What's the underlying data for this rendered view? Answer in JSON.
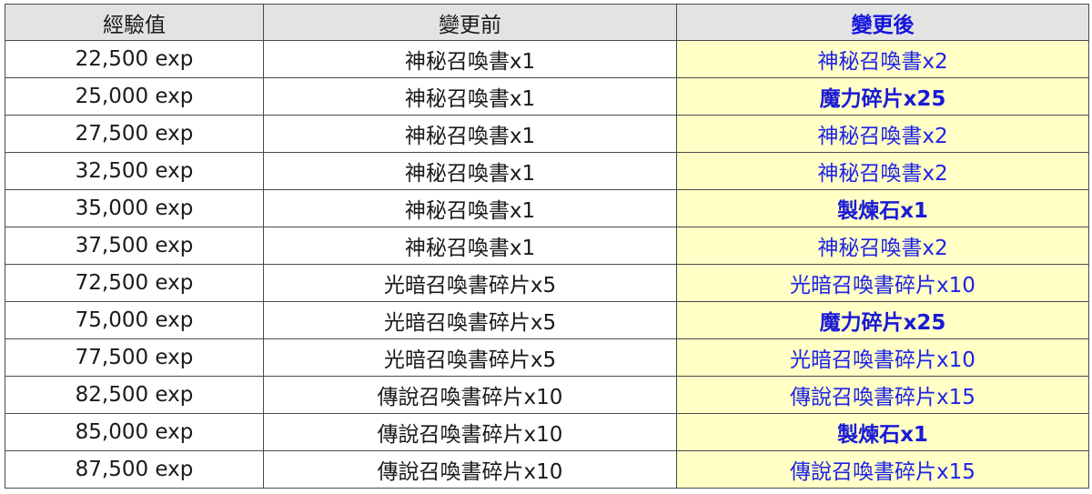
{
  "table": {
    "headers": {
      "exp": "經驗值",
      "before": "變更前",
      "after": "變更後"
    },
    "rows": [
      {
        "exp": "22,500 exp",
        "before": "神秘召喚書x1",
        "after": "神秘召喚書x2",
        "after_bold": false
      },
      {
        "exp": "25,000 exp",
        "before": "神秘召喚書x1",
        "after": "魔力碎片x25",
        "after_bold": true
      },
      {
        "exp": "27,500 exp",
        "before": "神秘召喚書x1",
        "after": "神秘召喚書x2",
        "after_bold": false
      },
      {
        "exp": "32,500 exp",
        "before": "神秘召喚書x1",
        "after": "神秘召喚書x2",
        "after_bold": false
      },
      {
        "exp": "35,000 exp",
        "before": "神秘召喚書x1",
        "after": "製煉石x1",
        "after_bold": true
      },
      {
        "exp": "37,500 exp",
        "before": "神秘召喚書x1",
        "after": "神秘召喚書x2",
        "after_bold": false
      },
      {
        "exp": "72,500 exp",
        "before": "光暗召喚書碎片x5",
        "after": "光暗召喚書碎片x10",
        "after_bold": false
      },
      {
        "exp": "75,000 exp",
        "before": "光暗召喚書碎片x5",
        "after": "魔力碎片x25",
        "after_bold": true
      },
      {
        "exp": "77,500 exp",
        "before": "光暗召喚書碎片x5",
        "after": "光暗召喚書碎片x10",
        "after_bold": false
      },
      {
        "exp": "82,500 exp",
        "before": "傳說召喚書碎片x10",
        "after": "傳說召喚書碎片x15",
        "after_bold": false
      },
      {
        "exp": "85,000 exp",
        "before": "傳說召喚書碎片x10",
        "after": "製煉石x1",
        "after_bold": true
      },
      {
        "exp": "87,500 exp",
        "before": "傳說召喚書碎片x10",
        "after": "傳說召喚書碎片x15",
        "after_bold": false
      }
    ]
  },
  "colors": {
    "header_bg": "#e3e3e3",
    "after_bg": "#ffffc6",
    "after_text": "#1e22e6",
    "border": "#4a4a4a"
  }
}
